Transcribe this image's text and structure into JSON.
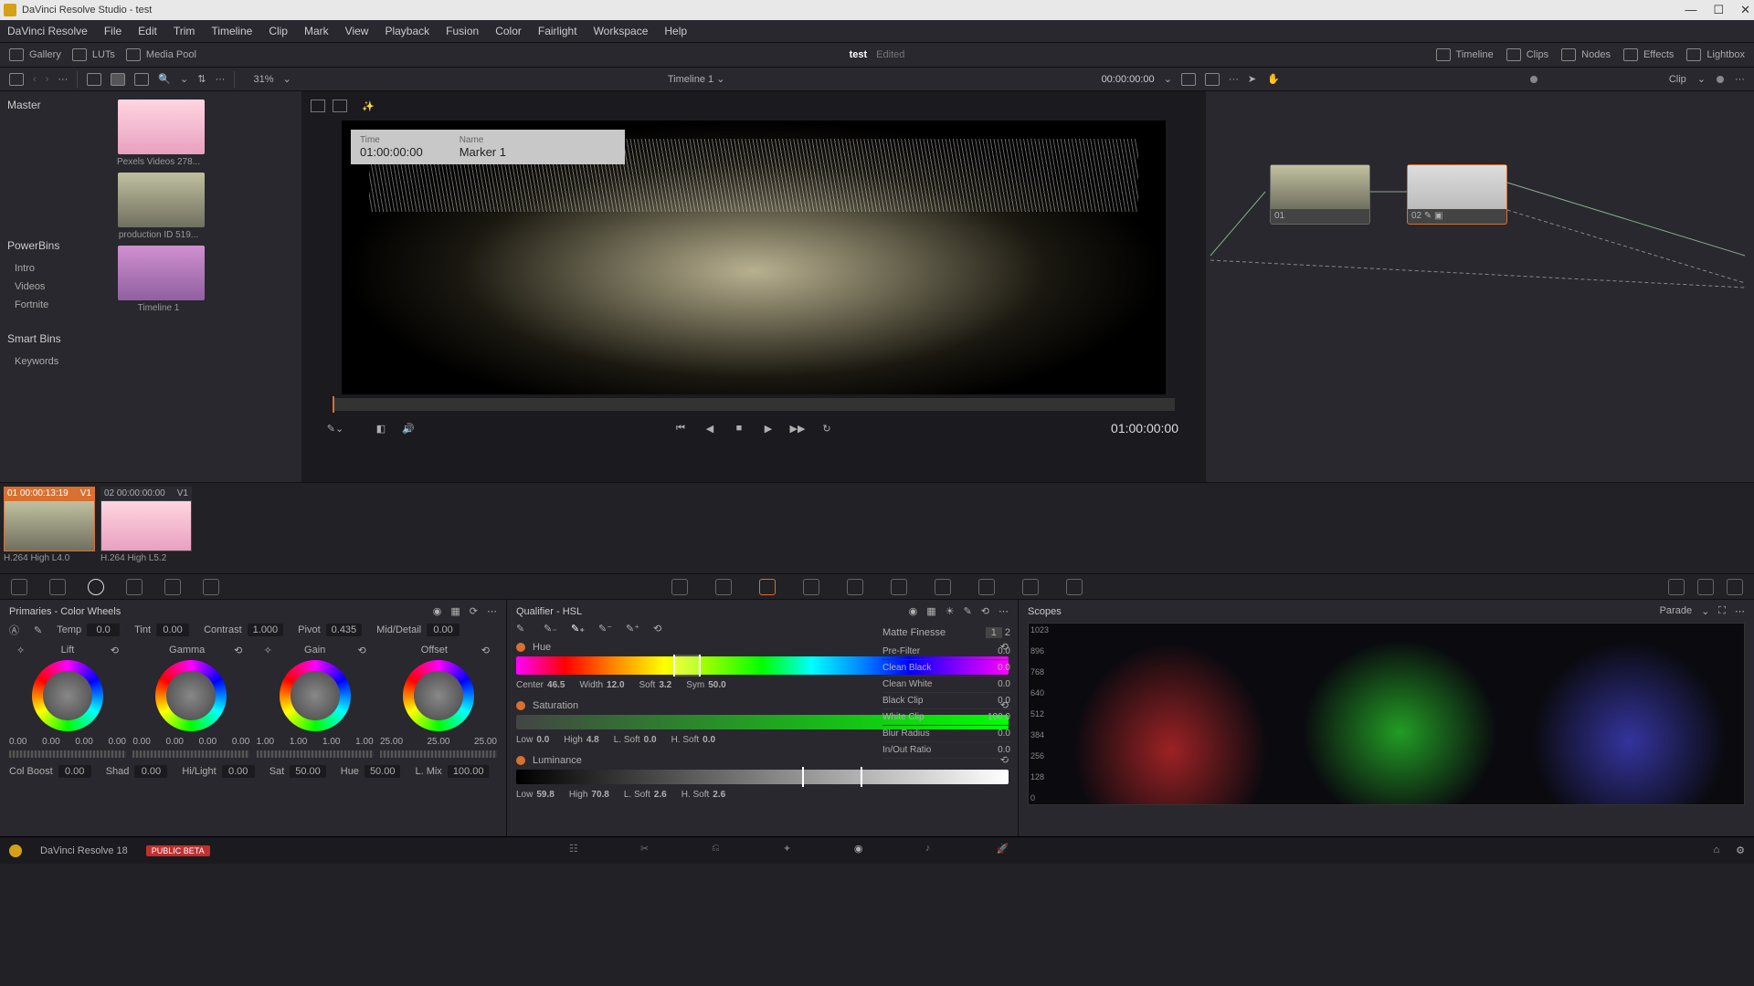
{
  "title": "DaVinci Resolve Studio - test",
  "menu": [
    "DaVinci Resolve",
    "File",
    "Edit",
    "Trim",
    "Timeline",
    "Clip",
    "Mark",
    "View",
    "Playback",
    "Fusion",
    "Color",
    "Fairlight",
    "Workspace",
    "Help"
  ],
  "toolbar": {
    "gallery": "Gallery",
    "luts": "LUTs",
    "mediapool": "Media Pool",
    "doc_name": "test",
    "edited": "Edited",
    "timeline_btn": "Timeline",
    "clips_btn": "Clips",
    "nodes_btn": "Nodes",
    "effects_btn": "Effects",
    "lightbox_btn": "Lightbox"
  },
  "secondbar": {
    "zoom": "31%",
    "timeline_name": "Timeline 1",
    "timecode": "00:00:00:00",
    "clip_label": "Clip"
  },
  "sidebar": {
    "master": "Master",
    "powerbins": "PowerBins",
    "powerbins_items": [
      "Intro",
      "Videos",
      "Fortnite"
    ],
    "smartbins": "Smart Bins",
    "smartbins_items": [
      "Keywords"
    ]
  },
  "clips": [
    {
      "label": "Pexels Videos 278..."
    },
    {
      "label": "production ID 519..."
    },
    {
      "label": "Timeline 1"
    }
  ],
  "viewer": {
    "marker_time_label": "Time",
    "marker_time": "01:00:00:00",
    "marker_name_label": "Name",
    "marker_name": "Marker 1",
    "timecode": "01:00:00:00"
  },
  "nodes": [
    {
      "id": "01"
    },
    {
      "id": "02"
    }
  ],
  "clipstrip": [
    {
      "num": "01",
      "tc": "00:00:13:19",
      "track": "V1",
      "codec": "H.264 High L4.0",
      "active": true
    },
    {
      "num": "02",
      "tc": "00:00:00:00",
      "track": "V1",
      "codec": "H.264 High L5.2",
      "active": false
    }
  ],
  "primaries": {
    "title": "Primaries - Color Wheels",
    "params": {
      "temp_lbl": "Temp",
      "temp": "0.0",
      "tint_lbl": "Tint",
      "tint": "0.00",
      "contrast_lbl": "Contrast",
      "contrast": "1.000",
      "pivot_lbl": "Pivot",
      "pivot": "0.435",
      "mid_lbl": "Mid/Detail",
      "mid": "0.00"
    },
    "wheels": [
      {
        "name": "Lift",
        "vals": [
          "0.00",
          "0.00",
          "0.00",
          "0.00"
        ]
      },
      {
        "name": "Gamma",
        "vals": [
          "0.00",
          "0.00",
          "0.00",
          "0.00"
        ]
      },
      {
        "name": "Gain",
        "vals": [
          "1.00",
          "1.00",
          "1.00",
          "1.00"
        ]
      },
      {
        "name": "Offset",
        "vals": [
          "25.00",
          "25.00",
          "25.00"
        ]
      }
    ],
    "bottom": {
      "colboost_lbl": "Col Boost",
      "colboost": "0.00",
      "shad_lbl": "Shad",
      "shad": "0.00",
      "hilight_lbl": "Hi/Light",
      "hilight": "0.00",
      "sat_lbl": "Sat",
      "sat": "50.00",
      "hue_lbl": "Hue",
      "hue": "50.00",
      "lmix_lbl": "L. Mix",
      "lmix": "100.00"
    }
  },
  "qualifier": {
    "title": "Qualifier - HSL",
    "hue": {
      "label": "Hue",
      "center_lbl": "Center",
      "center": "46.5",
      "width_lbl": "Width",
      "width": "12.0",
      "soft_lbl": "Soft",
      "soft": "3.2",
      "sym_lbl": "Sym",
      "sym": "50.0"
    },
    "sat": {
      "label": "Saturation",
      "low_lbl": "Low",
      "low": "0.0",
      "high_lbl": "High",
      "high": "4.8",
      "lsoft_lbl": "L. Soft",
      "lsoft": "0.0",
      "hsoft_lbl": "H. Soft",
      "hsoft": "0.0"
    },
    "lum": {
      "label": "Luminance",
      "low_lbl": "Low",
      "low": "59.8",
      "high_lbl": "High",
      "high": "70.8",
      "lsoft_lbl": "L. Soft",
      "lsoft": "2.6",
      "hsoft_lbl": "H. Soft",
      "hsoft": "2.6"
    },
    "matte": {
      "title": "Matte Finesse",
      "tab1": "1",
      "tab2": "2",
      "rows": [
        {
          "lbl": "Pre-Filter",
          "val": "0.0"
        },
        {
          "lbl": "Clean Black",
          "val": "0.0"
        },
        {
          "lbl": "Clean White",
          "val": "0.0"
        },
        {
          "lbl": "Black Clip",
          "val": "0.0"
        },
        {
          "lbl": "White Clip",
          "val": "100.0"
        },
        {
          "lbl": "Blur Radius",
          "val": "0.0"
        },
        {
          "lbl": "In/Out Ratio",
          "val": "0.0"
        }
      ]
    }
  },
  "scopes": {
    "title": "Scopes",
    "mode": "Parade",
    "levels": [
      "1023",
      "896",
      "768",
      "640",
      "512",
      "384",
      "256",
      "128",
      "0"
    ]
  },
  "footer": {
    "version": "DaVinci Resolve 18",
    "beta": "PUBLIC BETA"
  }
}
